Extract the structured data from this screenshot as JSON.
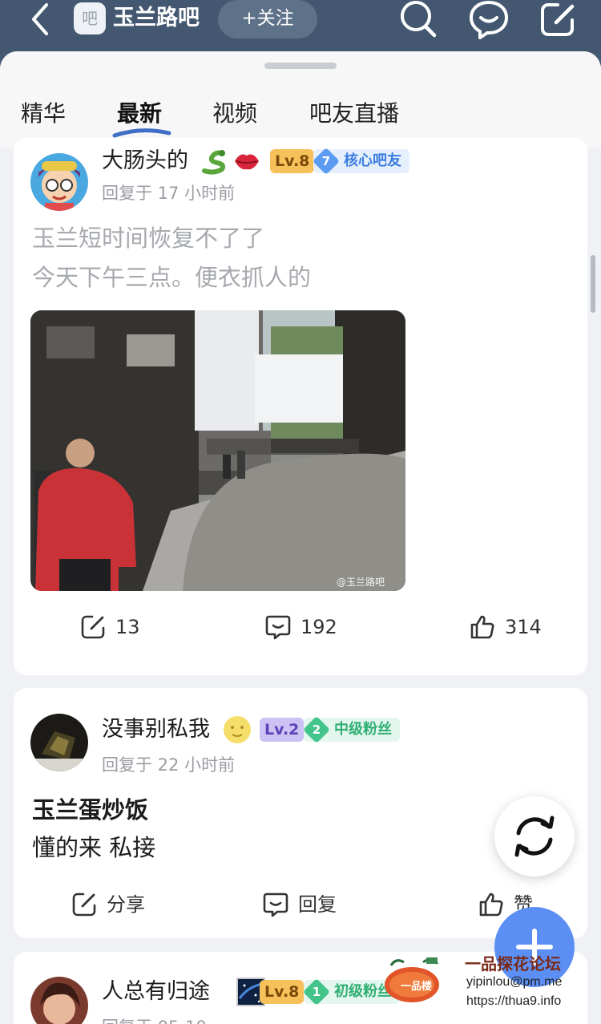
{
  "topbar": {
    "forum_icon_char": "吧",
    "forum_name": "玉兰路吧",
    "follow_label": "+关注",
    "icons": [
      "back-icon",
      "search-icon",
      "message-icon",
      "edit-icon"
    ]
  },
  "tabs": [
    {
      "label": "精华",
      "active": false
    },
    {
      "label": "最新",
      "active": true
    },
    {
      "label": "视频",
      "active": false
    },
    {
      "label": "吧友直播",
      "active": false
    }
  ],
  "posts": [
    {
      "username": "大肠头的",
      "username_emojis": [
        "snake-emoji",
        "lips-emoji"
      ],
      "level": "Lv.8",
      "badge_num": "7",
      "badge_label": "核心吧友",
      "meta": "回复于 17 小时前",
      "lines": [
        "玉兰短时间恢复不了了",
        "今天下午三点。便衣抓人的"
      ],
      "image_watermark": "@玉兰路吧",
      "share": "13",
      "reply": "192",
      "like": "314"
    },
    {
      "username": "没事别私我",
      "username_emojis": [
        "moon-face-emoji"
      ],
      "level": "Lv.2",
      "badge_num": "2",
      "badge_label": "中级粉丝",
      "meta": "回复于 22 小时前",
      "lines": [
        "玉兰蛋炒饭",
        "懂的来 私接"
      ],
      "share": "分享",
      "reply": "回复",
      "like": "赞"
    },
    {
      "username": "人总有归途",
      "username_emojis": [
        "starry-night-emoji"
      ],
      "level": "Lv.8",
      "badge_num": "1",
      "badge_label": "初级粉丝",
      "meta": "回复于 05-10"
    }
  ],
  "watermark": {
    "logo_text": "一品楼",
    "title": "一品探花论坛",
    "email": "yipinlou@pm.me",
    "url": "https://thua9.info"
  },
  "colors": {
    "topbar": "#435870",
    "accent_blue": "#5b8ff3",
    "lv8_badge": "#f6c15a",
    "lv2_badge": "#b7a7ee",
    "core_badge": "#5b9bf2",
    "mid_fan_badge": "#43c48b"
  }
}
